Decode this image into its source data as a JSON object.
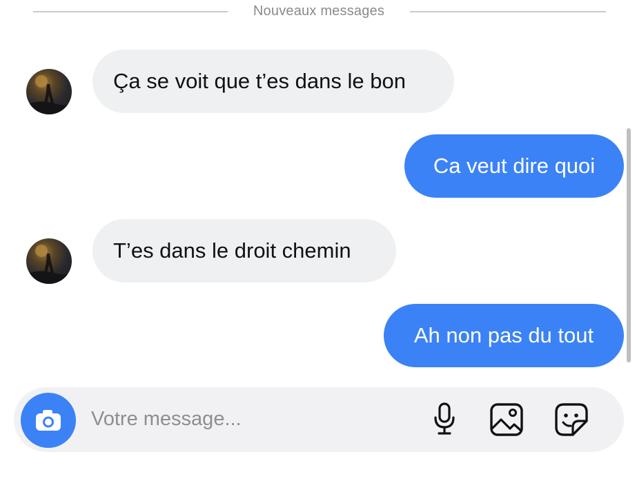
{
  "divider": {
    "label": "Nouveaux messages"
  },
  "messages": [
    {
      "direction": "incoming",
      "text": "Ça se voit que t’es dans le bon"
    },
    {
      "direction": "outgoing",
      "text": "Ca veut dire quoi"
    },
    {
      "direction": "incoming",
      "text": "T’es dans le droit chemin"
    },
    {
      "direction": "outgoing",
      "text": "Ah non pas du tout"
    }
  ],
  "composer": {
    "placeholder": "Votre message...",
    "value": "",
    "icons": [
      "camera-icon",
      "microphone-icon",
      "image-icon",
      "sticker-icon"
    ]
  },
  "colors": {
    "accent": "#3b82f6",
    "incoming_bubble": "#eff0f2",
    "divider_text": "#8a8a8a",
    "placeholder": "#8e8e8e"
  }
}
